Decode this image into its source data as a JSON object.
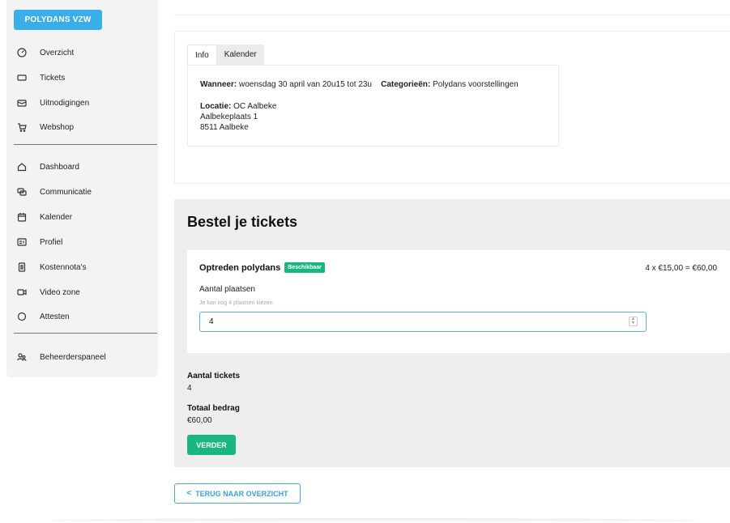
{
  "sidebar": {
    "org_label": "POLYDANS VZW",
    "group1": [
      {
        "label": "Overzicht",
        "icon": "gauge-icon"
      },
      {
        "label": "Tickets",
        "icon": "ticket-icon"
      },
      {
        "label": "Uitnodigingen",
        "icon": "envelope-icon"
      },
      {
        "label": "Webshop",
        "icon": "cart-icon"
      }
    ],
    "group2": [
      {
        "label": "Dashboard",
        "icon": "home-icon"
      },
      {
        "label": "Communicatie",
        "icon": "chat-icon"
      },
      {
        "label": "Kalender",
        "icon": "calendar-icon"
      },
      {
        "label": "Profiel",
        "icon": "profile-card-icon"
      },
      {
        "label": "Kostennota's",
        "icon": "document-icon"
      },
      {
        "label": "Video zone",
        "icon": "video-icon"
      },
      {
        "label": "Attesten",
        "icon": "circle-icon"
      }
    ],
    "group3": [
      {
        "label": "Beheerderspaneel",
        "icon": "users-icon"
      }
    ]
  },
  "event": {
    "tabs": [
      "Info",
      "Kalender"
    ],
    "when_label": "Wanneer:",
    "when_value": "woensdag 30 april van 20u15 tot 23u",
    "categories_label": "Categorieën:",
    "categories_value": "Polydans voorstellingen",
    "location_label": "Locatie:",
    "location_name": "OC Aalbeke",
    "address_line1": "Aalbekeplaats 1",
    "address_line2": "8511 Aalbeke"
  },
  "order": {
    "title": "Bestel je tickets",
    "ticket_name": "Optreden polydans",
    "badge": "Beschikbaar",
    "price_calc": "4 x €15,00 = €60,00",
    "qty_label": "Aantal plaatsen",
    "qty_hint": "Je kan nog 4 plaatsen kiezen",
    "qty_value": "4",
    "tickets_label": "Aantal tickets",
    "tickets_value": "4",
    "total_label": "Totaal bedrag",
    "total_value": "€60,00",
    "next_button": "VERDER"
  },
  "back_button": "TERUG NAAR OVERZICHT",
  "colors": {
    "primary_blue": "#3aaee8",
    "success_green": "#19b77e"
  }
}
